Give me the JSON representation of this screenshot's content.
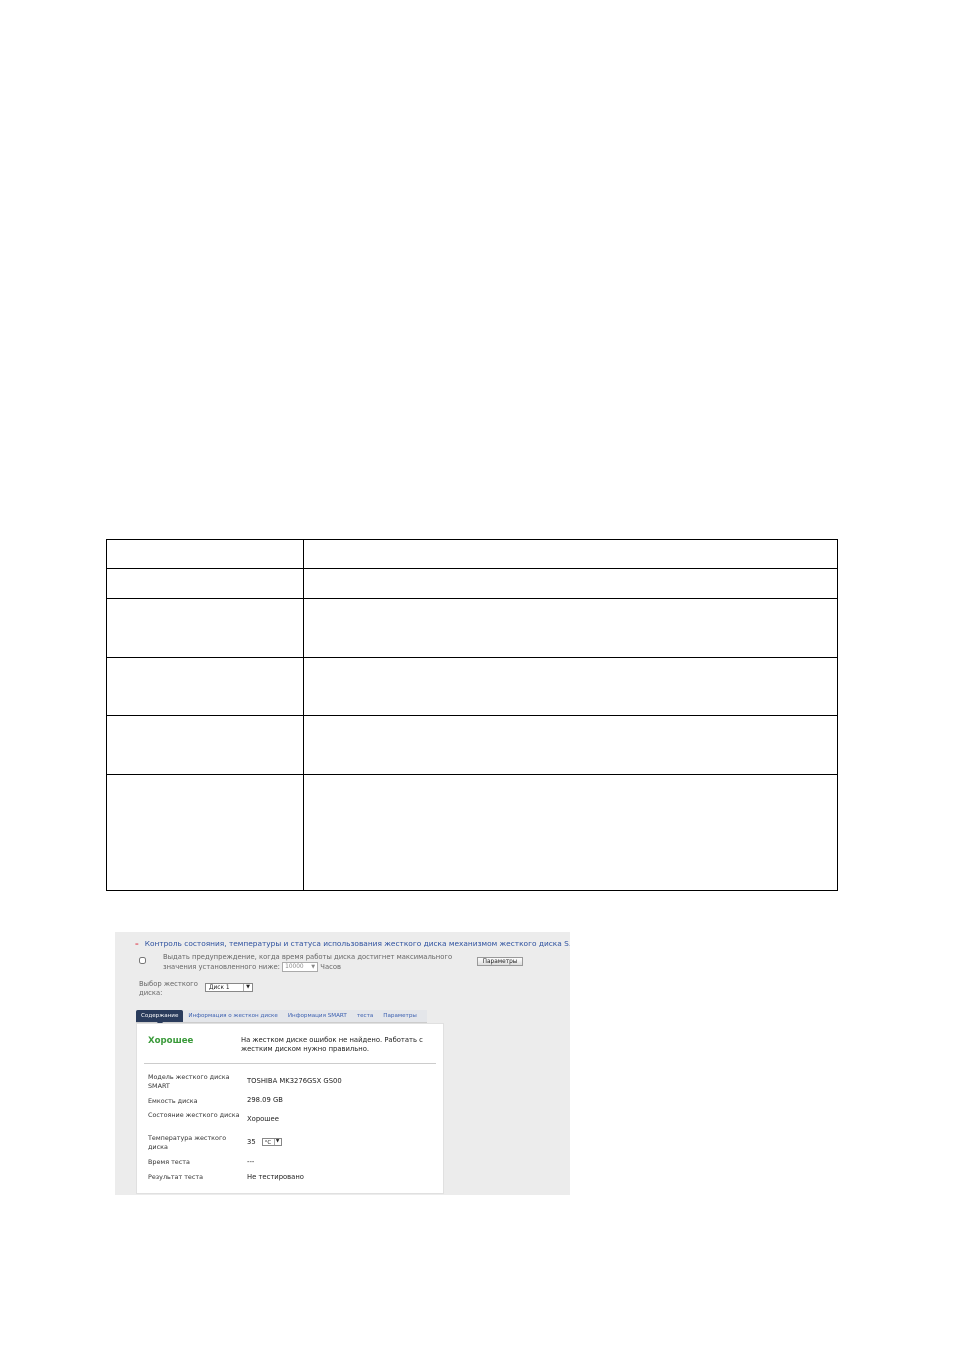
{
  "document_table": {
    "rows": [
      [
        "",
        ""
      ],
      [
        "",
        ""
      ],
      [
        "",
        ""
      ],
      [
        "",
        ""
      ],
      [
        "",
        ""
      ],
      [
        "",
        ""
      ]
    ]
  },
  "smart_panel": {
    "header": {
      "collapse_symbol": "–",
      "title": "Контроль состояния, температуры и статуса использования жесткого диска механизмом жесткого диска S.M.A.R.T."
    },
    "warning": {
      "text": "Выдать предупреждение, когда время работы диска достигнет максимального значения установленного ниже:",
      "hours_value": "10000",
      "hours_unit": "Часов",
      "params_button": "Параметры"
    },
    "disk_select": {
      "label": "Выбор жесткого диска:",
      "value": "Диск 1"
    },
    "tabs": [
      {
        "label": "Содержание",
        "active": true
      },
      {
        "label": "Информация о жесткон диске",
        "active": false
      },
      {
        "label": "Информация SMART",
        "active": false
      },
      {
        "label": "теста",
        "active": false
      },
      {
        "label": "Параметры",
        "active": false
      }
    ],
    "summary": {
      "status": "Хорошее",
      "status_color": "#3a9a3a",
      "message": "На жестком диске ошибок не найдено. Работать с жестким диском нужно правильно."
    },
    "details": [
      {
        "label": "Модель жесткого диска SMART",
        "value": "TOSHIBA MK3276GSX GS00"
      },
      {
        "label": "Емкость диска",
        "value": "298.09 GB"
      },
      {
        "label": "Состояние жесткого диска",
        "value": "Хорошее"
      },
      {
        "label": "Температура жесткого диска",
        "value": "35",
        "unit": "°C"
      },
      {
        "label": "Время теста",
        "value": "---"
      },
      {
        "label": "Результат теста",
        "value": "Не тестировано"
      }
    ]
  }
}
